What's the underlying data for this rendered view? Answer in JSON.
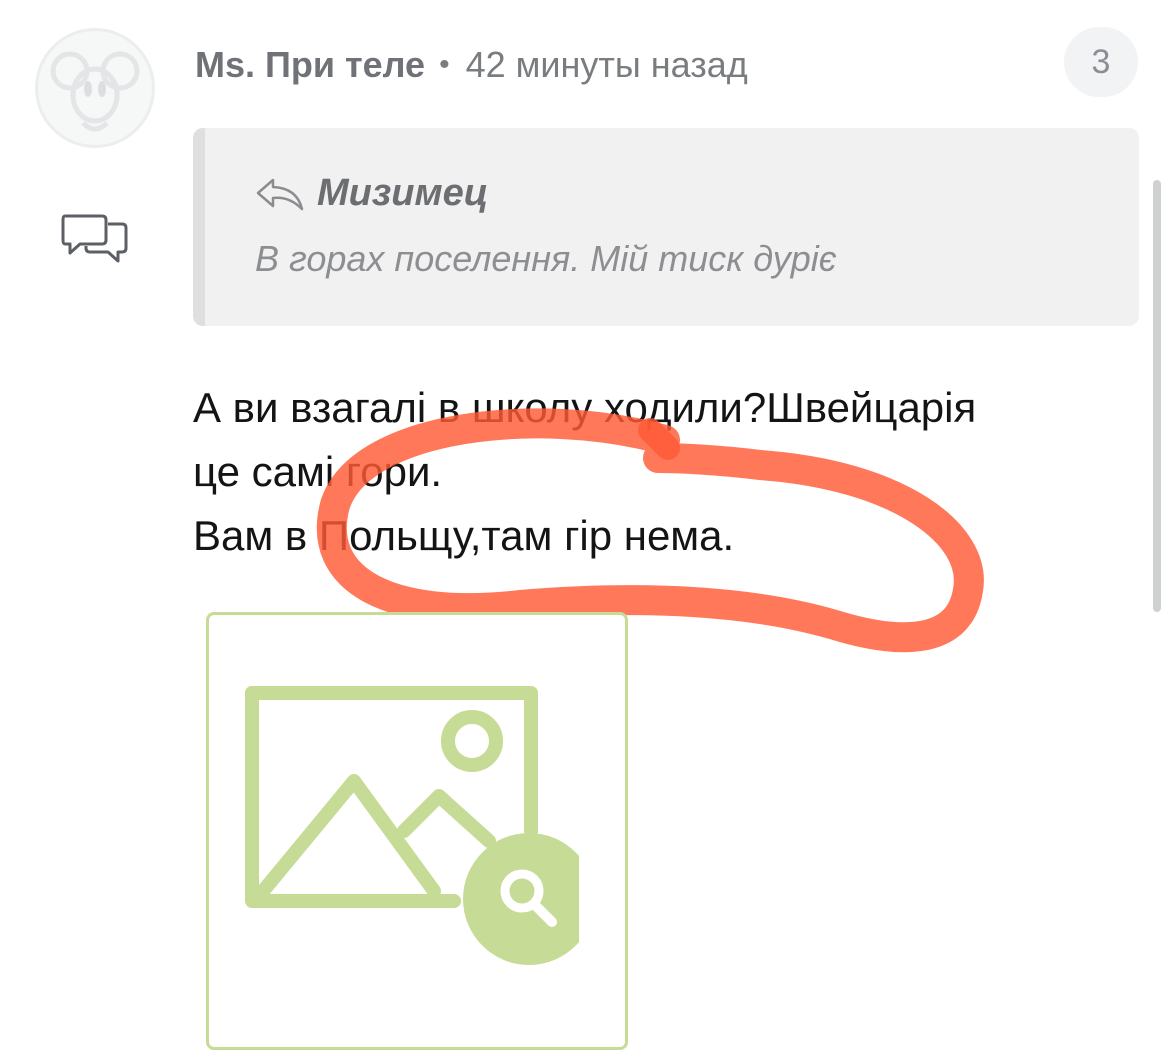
{
  "comment": {
    "author": "Ms. При теле",
    "separator": "•",
    "time": "42 минуты назад",
    "reply_count": "3",
    "quote": {
      "author": "Мизимец",
      "text": "В горах поселення. Мій тиск дуріє"
    },
    "body_lines": [
      "А ви взагалі в школу ходили?Швейцарія",
      "це самі гори.",
      "Вам в Польщу,там гір нема."
    ]
  },
  "colors": {
    "highlight": "#ff5a36",
    "image_placeholder": "#c6dc96",
    "quote_bg": "#f1f1f1"
  },
  "icons": {
    "avatar": "cartoon-character-avatar",
    "reply": "speech-bubbles-icon",
    "quote_reply": "reply-arrow-icon",
    "image": "image-search-icon"
  }
}
